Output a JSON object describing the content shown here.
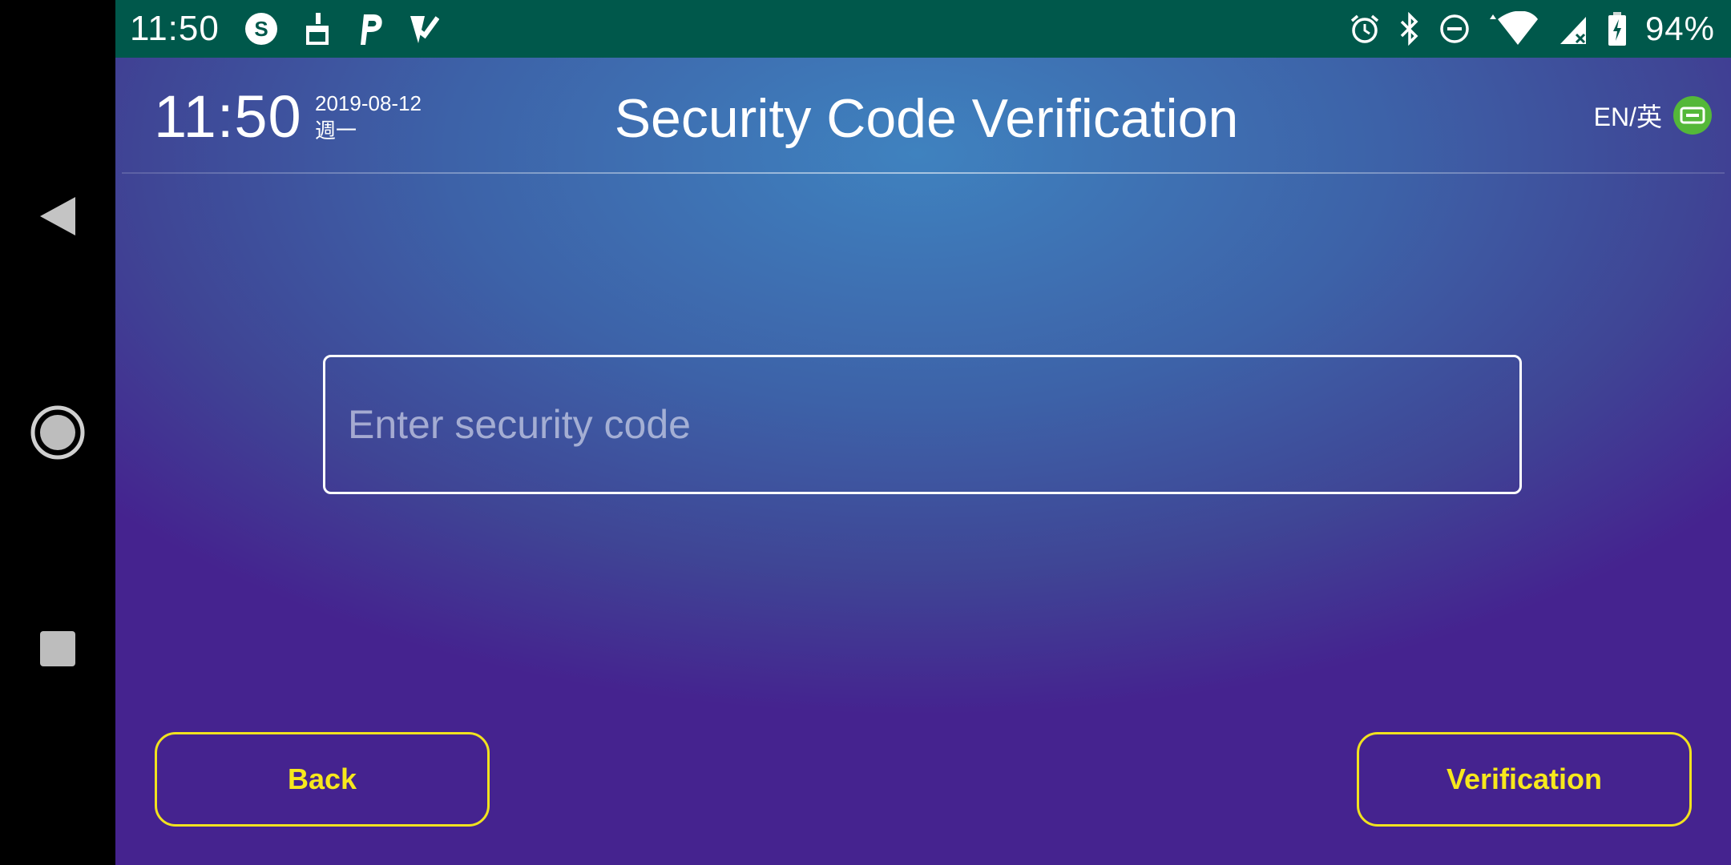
{
  "status_bar": {
    "time": "11:50",
    "battery_percent": "94%",
    "left_icons": [
      "s-app-icon",
      "clean-brush-icon",
      "p-app-icon",
      "check-app-icon"
    ],
    "right_icons": [
      "alarm-icon",
      "bluetooth-icon",
      "do-not-disturb-icon",
      "wifi-icon",
      "signal-icon",
      "battery-charging-icon"
    ]
  },
  "header": {
    "time": "11:50",
    "date": "2019-08-12",
    "weekday": "週一",
    "title": "Security Code Verification",
    "language_label": "EN/英"
  },
  "form": {
    "code_placeholder": "Enter security code",
    "code_value": ""
  },
  "buttons": {
    "back_label": "Back",
    "verify_label": "Verification"
  },
  "colors": {
    "status_bar": "#00584b",
    "button_accent": "#f1e21f",
    "language_badge": "#54b839"
  }
}
